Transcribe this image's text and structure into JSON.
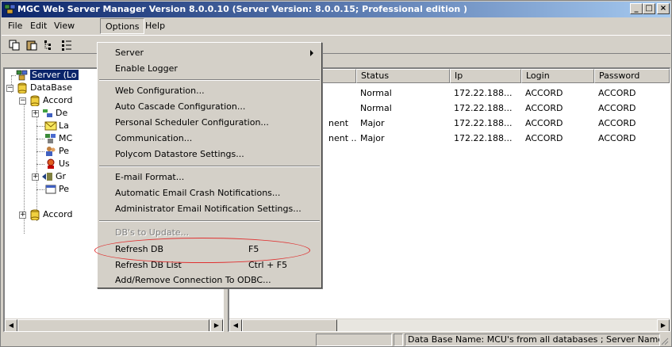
{
  "window": {
    "title": "MGC Web Server Manager Version 8.0.0.10 (Server Version: 8.0.0.15;  Professional edition )",
    "minimize": "_",
    "maximize": "□",
    "close": "×"
  },
  "menubar": {
    "items": [
      {
        "label": "File"
      },
      {
        "label": "Edit"
      },
      {
        "label": "View"
      },
      {
        "label": "Options"
      },
      {
        "label": "Help"
      }
    ]
  },
  "options_menu": {
    "items": [
      {
        "label": "Server",
        "submenu": true
      },
      {
        "label": "Enable Logger"
      },
      {
        "label": "Web Configuration..."
      },
      {
        "label": "Auto Cascade Configuration..."
      },
      {
        "label": "Personal Scheduler Configuration..."
      },
      {
        "label": "Communication..."
      },
      {
        "label": "Polycom Datastore Settings..."
      },
      {
        "label": "E-mail Format..."
      },
      {
        "label": "Automatic Email Crash Notifications..."
      },
      {
        "label": "Administrator Email Notification Settings..."
      },
      {
        "label": "DB's to Update...",
        "disabled": true
      },
      {
        "label": "Refresh DB",
        "shortcut": "F5"
      },
      {
        "label": "Refresh DB List",
        "shortcut": "Ctrl + F5"
      },
      {
        "label": "Add/Remove Connection To ODBC..."
      }
    ]
  },
  "tree": {
    "items": [
      {
        "label": "Server (Lo"
      },
      {
        "label": "DataBase"
      },
      {
        "label": "Accord"
      },
      {
        "label": "De"
      },
      {
        "label": "La"
      },
      {
        "label": "MC"
      },
      {
        "label": "Pe"
      },
      {
        "label": "Us"
      },
      {
        "label": "Gr"
      },
      {
        "label": "Pe"
      },
      {
        "label": "Accord"
      }
    ]
  },
  "list": {
    "partial_col": [
      "",
      "",
      "nent",
      "nent ..."
    ],
    "columns": [
      "Status",
      "Ip",
      "Login",
      "Password"
    ],
    "rows": [
      [
        "Normal",
        "172.22.188...",
        "ACCORD",
        "ACCORD"
      ],
      [
        "Normal",
        "172.22.188...",
        "ACCORD",
        "ACCORD"
      ],
      [
        "Major",
        "172.22.188...",
        "ACCORD",
        "ACCORD"
      ],
      [
        "Major",
        "172.22.188...",
        "ACCORD",
        "ACCORD"
      ]
    ]
  },
  "statusbar": {
    "text": "Data Base Name: MCU's from all databases ; Server Name"
  },
  "colors": {
    "title_start": "#0a246a",
    "title_end": "#a6caf0",
    "highlight_ring": "#e03030"
  }
}
